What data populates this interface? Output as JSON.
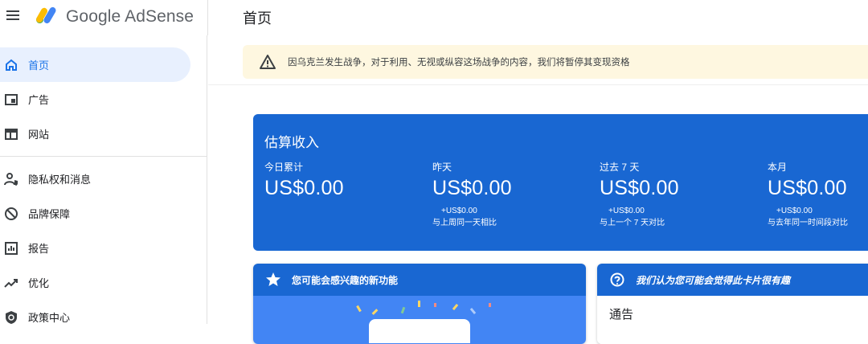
{
  "header": {
    "brand": "Google AdSense",
    "page_title": "首页"
  },
  "sidebar": {
    "items": [
      {
        "label": "首页",
        "icon": "home-icon",
        "active": true
      },
      {
        "label": "广告",
        "icon": "ads-icon",
        "active": false
      },
      {
        "label": "网站",
        "icon": "sites-icon",
        "active": false
      },
      {
        "label": "隐私权和消息",
        "icon": "privacy-icon",
        "active": false
      },
      {
        "label": "品牌保障",
        "icon": "block-icon",
        "active": false
      },
      {
        "label": "报告",
        "icon": "report-icon",
        "active": false
      },
      {
        "label": "优化",
        "icon": "trending-icon",
        "active": false
      },
      {
        "label": "政策中心",
        "icon": "policy-icon",
        "active": false
      }
    ]
  },
  "warning": {
    "icon": "warning-icon",
    "text": "因乌克兰发生战争，对于利用、无视或纵容这场战争的内容，我们将暂停其变现资格"
  },
  "earnings": {
    "title": "估算收入",
    "columns": [
      {
        "label": "今日累计",
        "value": "US$0.00",
        "diff": "",
        "compare": ""
      },
      {
        "label": "昨天",
        "value": "US$0.00",
        "diff": "+US$0.00",
        "compare": "与上周同一天相比"
      },
      {
        "label": "过去 7 天",
        "value": "US$0.00",
        "diff": "+US$0.00",
        "compare": "与上一个 7 天对比"
      },
      {
        "label": "本月",
        "value": "US$0.00",
        "diff": "+US$0.00",
        "compare": "与去年同一时间段对比"
      }
    ]
  },
  "cards": {
    "features": {
      "icon": "star-icon",
      "title": "您可能会感兴趣的新功能"
    },
    "suggestion": {
      "icon": "lightbulb-icon",
      "title": "我们认为您可能会觉得此卡片很有趣",
      "body": "通告"
    }
  },
  "colors": {
    "brand_blue": "#1967d2",
    "warning_bg": "#fef7e0",
    "active_nav_bg": "#e8f0fe"
  }
}
